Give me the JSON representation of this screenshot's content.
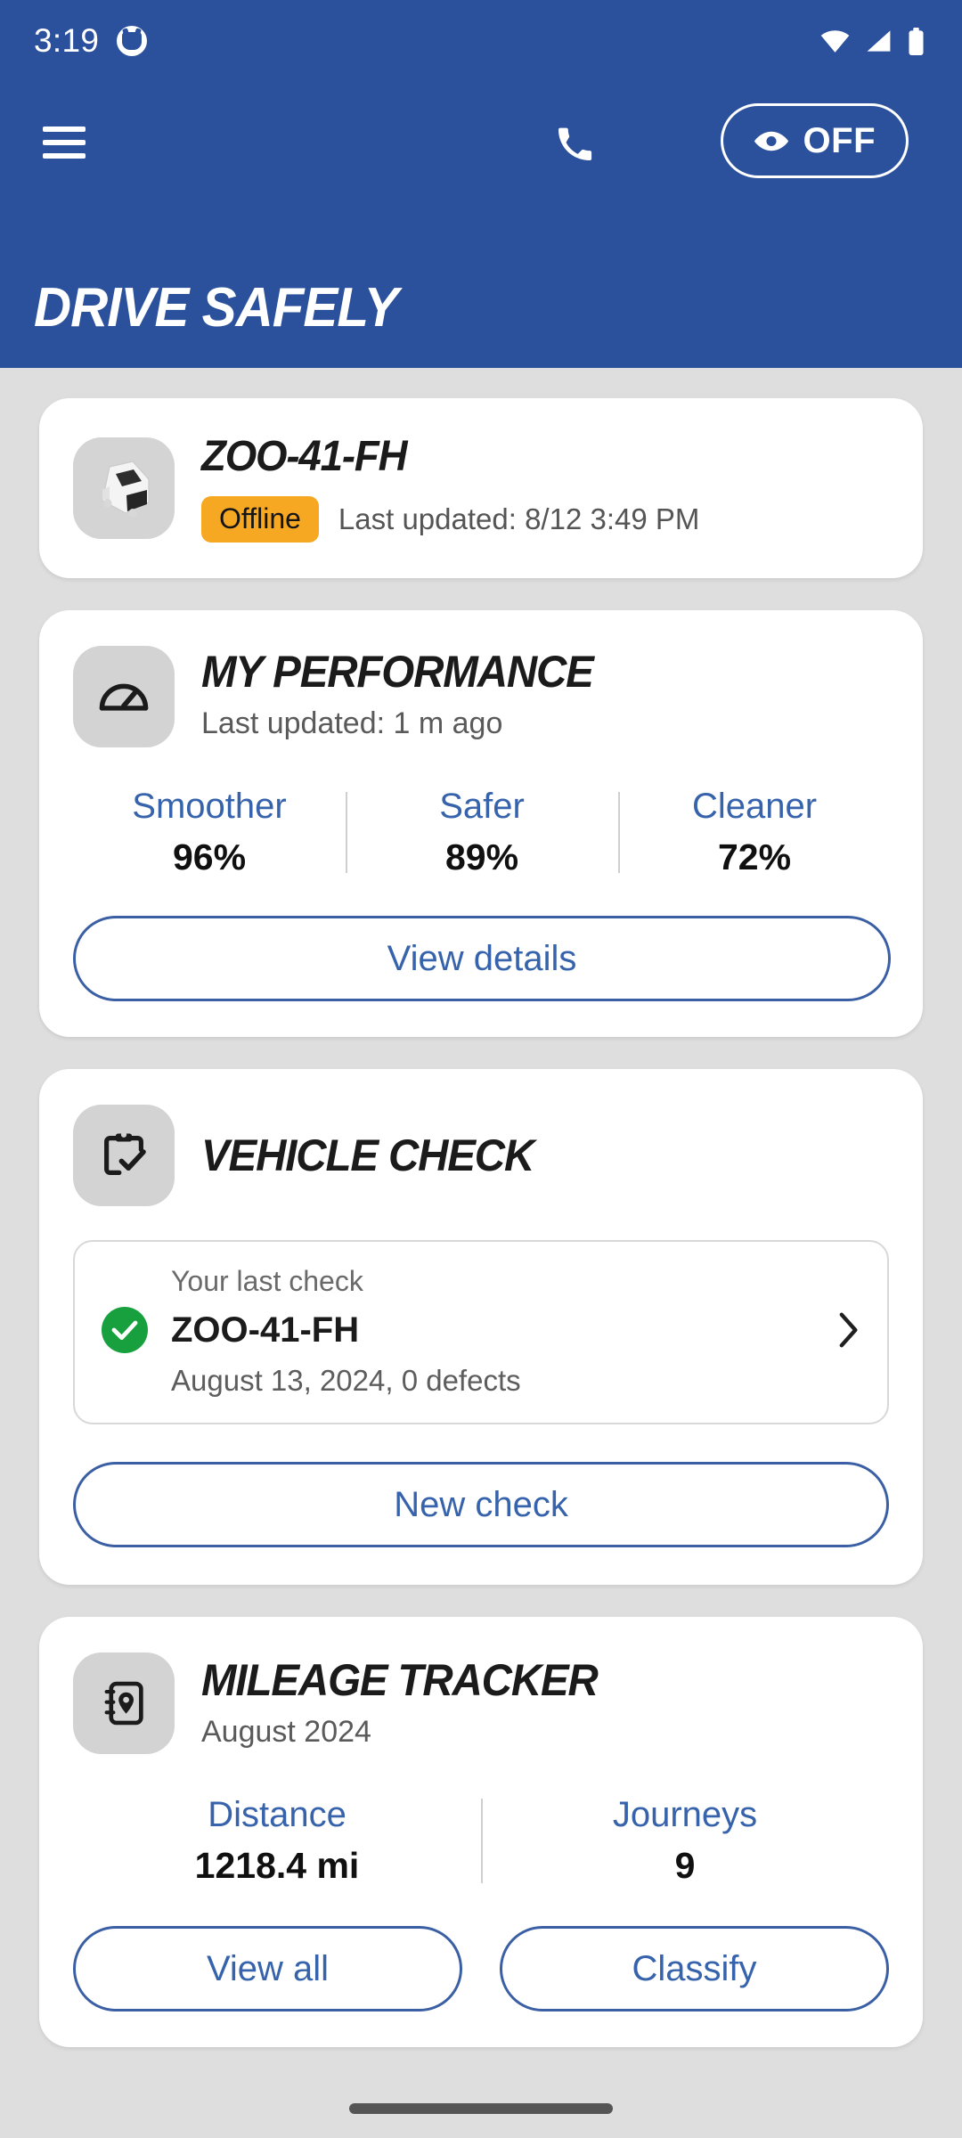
{
  "status_bar": {
    "time": "3:19",
    "notification_icon": "notification-face-icon",
    "wifi_icon": "wifi-icon",
    "cellular_icon": "cellular-signal-icon",
    "battery_icon": "battery-full-icon"
  },
  "app_bar": {
    "menu_icon": "hamburger-menu-icon",
    "phone_icon": "phone-icon",
    "eye_icon": "eye-icon",
    "toggle_label": "OFF",
    "brand_title": "DRIVE SAFELY",
    "header_color": "#2b519c"
  },
  "vehicle_card": {
    "thumbnail_icon": "van-photo",
    "plate": "ZOO-41-FH",
    "status_badge": "Offline",
    "badge_color": "#f6a823",
    "last_updated": "Last updated: 8/12 3:49 PM"
  },
  "performance_card": {
    "icon": "speedometer-icon",
    "title": "MY PERFORMANCE",
    "subtitle": "Last updated: 1 m ago",
    "metrics": [
      {
        "label": "Smoother",
        "value": "96%"
      },
      {
        "label": "Safer",
        "value": "89%"
      },
      {
        "label": "Cleaner",
        "value": "72%"
      }
    ],
    "button_label": "View details"
  },
  "vehicle_check_card": {
    "icon": "clipboard-check-icon",
    "title": "VEHICLE CHECK",
    "last_check_label": "Your last check",
    "status_icon": "green-check-icon",
    "plate": "ZOO-41-FH",
    "detail": "August 13, 2024, 0 defects",
    "chevron_icon": "chevron-right-icon",
    "button_label": "New check"
  },
  "mileage_card": {
    "icon": "logbook-location-icon",
    "title": "MILEAGE TRACKER",
    "subtitle": "August 2024",
    "metrics": [
      {
        "label": "Distance",
        "value": "1218.4 mi"
      },
      {
        "label": "Journeys",
        "value": "9"
      }
    ],
    "buttons": [
      {
        "label": "View all"
      },
      {
        "label": "Classify"
      }
    ]
  },
  "theme": {
    "accent_blue": "#3663ab",
    "header_blue": "#2b519c",
    "page_background": "#dedede",
    "card_background": "#ffffff",
    "success_green": "#17a03d"
  }
}
